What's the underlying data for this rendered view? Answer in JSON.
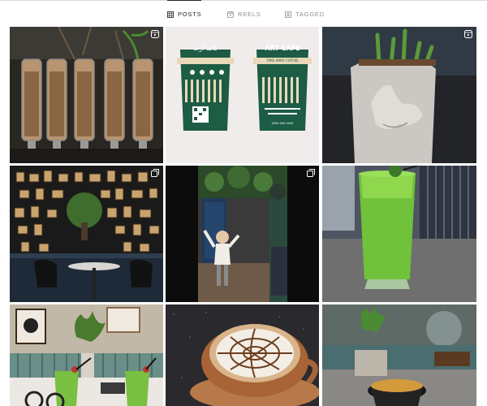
{
  "tabs": [
    {
      "label": "POSTS",
      "active": true,
      "icon": "grid-icon"
    },
    {
      "label": "REELS",
      "active": false,
      "icon": "reels-icon"
    },
    {
      "label": "TAGGED",
      "active": false,
      "icon": "tagged-icon"
    }
  ],
  "posts": [
    {
      "subject": "coffee-bean-dispensers",
      "badge": "reel-icon"
    },
    {
      "subject": "branded-coffee-cups",
      "badge": null,
      "cup_left": {
        "title": "کافه آرت"
      },
      "cup_right": {
        "title": "ART CAFE",
        "subtitle": "TAKE AWAY COFFEE",
        "footer": "0000 000 0000"
      }
    },
    {
      "subject": "face-planter-with-cactus",
      "badge": "reel-icon"
    },
    {
      "subject": "frame-wall-interior",
      "badge": "carousel-icon"
    },
    {
      "subject": "child-in-cafe",
      "badge": "carousel-icon"
    },
    {
      "subject": "green-drink",
      "badge": null
    },
    {
      "subject": "green-drinks-on-table",
      "badge": null
    },
    {
      "subject": "latte-art",
      "badge": null
    },
    {
      "subject": "coffee-cup-with-plant",
      "badge": null
    }
  ],
  "colors": {
    "accent": "#262626",
    "muted": "#8e8e8e",
    "divider": "#dbdbdb",
    "cup_green": "#1d5c45"
  }
}
